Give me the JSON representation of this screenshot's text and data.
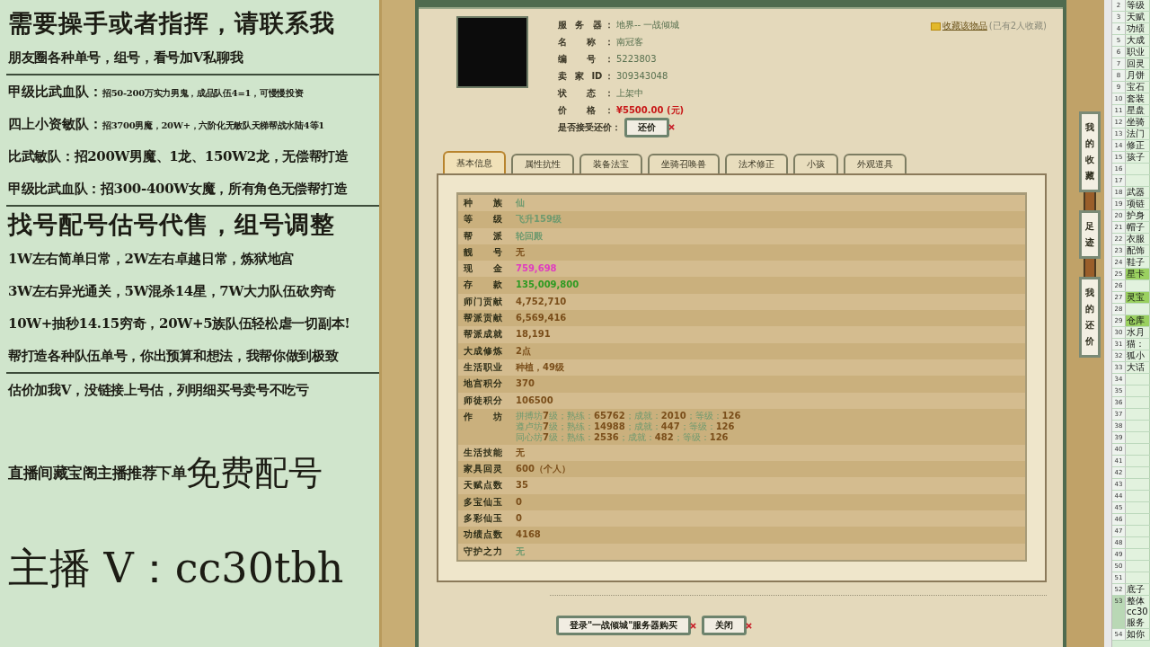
{
  "promo": {
    "items": [
      {
        "kind": "headline",
        "text": "需要操手或者指挥，请联系我"
      },
      {
        "kind": "line",
        "text": "朋友圈各种单号，组号，看号加V私聊我"
      },
      {
        "kind": "rule"
      },
      {
        "kind": "pair",
        "label": "甲级比武血队：",
        "text": "招50-200万实力男鬼，成品队伍4=1，可慢慢投资"
      },
      {
        "kind": "pair",
        "label": "四上小资敏队：",
        "text": "招3700男魔，20W+，六阶化无敏队天梯帮战水陆4等1"
      },
      {
        "kind": "line",
        "text": "比武敏队：招200W男魔、1龙、150W2龙，无偿帮打造"
      },
      {
        "kind": "line",
        "text": "甲级比武血队：招300-400W女魔，所有角色无偿帮打造"
      },
      {
        "kind": "rule"
      },
      {
        "kind": "headline",
        "text": "找号配号估号代售，组号调整"
      },
      {
        "kind": "line",
        "text": "1W左右简单日常，2W左右卓越日常，炼狱地宫"
      },
      {
        "kind": "line",
        "text": "3W左右异光通关，5W混杀14星，7W大力队伍砍穷奇"
      },
      {
        "kind": "line",
        "text": "10W+抽秒14.15穷奇，20W+5族队伍轻松虐一切副本!"
      },
      {
        "kind": "line",
        "text": "帮打造各种队伍单号，你出预算和想法，我帮你做到极致"
      },
      {
        "kind": "rule"
      },
      {
        "kind": "line",
        "text": "估价加我V，没链接上号估，列明细买号卖号不吃亏"
      },
      {
        "kind": "emphasis",
        "text": "直播间藏宝阁主播推荐下单",
        "big": "免费配号"
      },
      {
        "kind": "contact",
        "text": "主播 V：cc30tbh"
      }
    ]
  },
  "listing": {
    "fields": [
      {
        "label": "服 务 器：",
        "value": "地界-- 一战倾城",
        "kind": "text"
      },
      {
        "label": "名 称：",
        "value": "南冠客",
        "kind": "text"
      },
      {
        "label": "编 号：",
        "value": "5223803",
        "kind": "text"
      },
      {
        "label": "卖 家 ID：",
        "value": "309343048",
        "kind": "text"
      },
      {
        "label": "状 态：",
        "value": "上架中",
        "kind": "text"
      },
      {
        "label": "价 格：",
        "value": "¥5500.00 (元)",
        "kind": "price"
      }
    ],
    "favorite": {
      "link": "收藏该物品",
      "count": "(已有2人收藏)"
    },
    "counter_offer": {
      "label": "是否接受还价：",
      "button": "还价"
    },
    "tabs": [
      {
        "label": "基本信息",
        "selected": true
      },
      {
        "label": "属性抗性",
        "selected": false
      },
      {
        "label": "装备法宝",
        "selected": false
      },
      {
        "label": "坐骑召唤兽",
        "selected": false
      },
      {
        "label": "法术修正",
        "selected": false
      },
      {
        "label": "小孩",
        "selected": false
      },
      {
        "label": "外观道具",
        "selected": false
      }
    ],
    "rows": [
      {
        "label": "种 族",
        "value": "仙",
        "color": "#6f9a6f"
      },
      {
        "label": "等 级",
        "value": "飞升159级",
        "color": "#6f9a6f"
      },
      {
        "label": "帮 派",
        "value": "轮回殿",
        "color": "#6f9a6f"
      },
      {
        "label": "靓 号",
        "value": "无",
        "color": "#7a4e1a"
      },
      {
        "label": "现 金",
        "value": "759,698",
        "color": "#e03cc0"
      },
      {
        "label": "存 款",
        "value": "135,009,800",
        "color": "#2e9a22"
      },
      {
        "label": "师门贡献",
        "value": "4,752,710",
        "color": "#7a4e1a"
      },
      {
        "label": "帮派贡献",
        "value": "6,569,416",
        "color": "#7a4e1a"
      },
      {
        "label": "帮派成就",
        "value": "18,191",
        "color": "#7a4e1a"
      },
      {
        "label": "大成修炼",
        "value": "2点",
        "color": "#7a4e1a"
      },
      {
        "label": "生活职业",
        "value": "种植，49级",
        "color": "#7a4e1a"
      },
      {
        "label": "地宫积分",
        "value": "370",
        "color": "#7a4e1a"
      },
      {
        "label": "师徒积分",
        "value": "106500",
        "color": "#7a4e1a"
      },
      {
        "label": "作 坊",
        "lines": [
          [
            "拼搏坊",
            "7",
            "级；熟练：",
            "65762",
            "；成就：",
            "2010",
            "；等级：",
            "126"
          ],
          [
            "遵卢坊",
            "7",
            "级；熟练：",
            "14988",
            "；成就：",
            "447",
            "；等级：",
            "126"
          ],
          [
            "同心坊",
            "7",
            "级；熟练：",
            "2536",
            "；成就：",
            "482",
            "；等级：",
            "126"
          ]
        ]
      },
      {
        "label": "生活技能",
        "value": "无",
        "color": "#7a4e1a"
      },
      {
        "label": "家具回灵",
        "value": "600（个人）",
        "color": "#7a4e1a"
      },
      {
        "label": "天赋点数",
        "value": "35",
        "color": "#7a4e1a"
      },
      {
        "label": "多宝仙玉",
        "value": "0",
        "color": "#7a4e1a"
      },
      {
        "label": "多彩仙玉",
        "value": "0",
        "color": "#7a4e1a"
      },
      {
        "label": "功绩点数",
        "value": "4168",
        "color": "#7a4e1a"
      },
      {
        "label": "守护之力",
        "value": "无",
        "color": "#6f9a6f"
      }
    ],
    "buttons": [
      "登录\"一战倾城\"服务器购买",
      "关闭"
    ]
  },
  "side_tabs": [
    "我的收藏",
    "足迹",
    "我的还价"
  ],
  "sheet": {
    "rows": [
      {
        "number": "2",
        "lines": [
          "等级"
        ],
        "highlighted": false,
        "selected": false
      },
      {
        "number": "3",
        "lines": [
          "天赋"
        ],
        "highlighted": false,
        "selected": false
      },
      {
        "number": "4",
        "lines": [
          "功绩"
        ],
        "highlighted": false,
        "selected": false
      },
      {
        "number": "5",
        "lines": [
          "大成"
        ],
        "highlighted": false,
        "selected": false
      },
      {
        "number": "6",
        "lines": [
          "职业"
        ],
        "highlighted": false,
        "selected": false
      },
      {
        "number": "7",
        "lines": [
          "回灵"
        ],
        "highlighted": false,
        "selected": false
      },
      {
        "number": "8",
        "lines": [
          "月饼"
        ],
        "highlighted": false,
        "selected": false
      },
      {
        "number": "9",
        "lines": [
          "宝石"
        ],
        "highlighted": false,
        "selected": false
      },
      {
        "number": "10",
        "lines": [
          "套装"
        ],
        "highlighted": false,
        "selected": false
      },
      {
        "number": "11",
        "lines": [
          "星盘"
        ],
        "highlighted": false,
        "selected": false
      },
      {
        "number": "12",
        "lines": [
          "坐骑"
        ],
        "highlighted": false,
        "selected": false
      },
      {
        "number": "13",
        "lines": [
          "法门"
        ],
        "highlighted": false,
        "selected": false
      },
      {
        "number": "14",
        "lines": [
          "修正"
        ],
        "highlighted": false,
        "selected": false
      },
      {
        "number": "15",
        "lines": [
          "孩子"
        ],
        "highlighted": false,
        "selected": false
      },
      {
        "number": "16",
        "lines": [],
        "highlighted": false,
        "selected": false
      },
      {
        "number": "17",
        "lines": [],
        "highlighted": false,
        "selected": false
      },
      {
        "number": "18",
        "lines": [
          "武器"
        ],
        "highlighted": false,
        "selected": false
      },
      {
        "number": "19",
        "lines": [
          "项链"
        ],
        "highlighted": false,
        "selected": false
      },
      {
        "number": "20",
        "lines": [
          "护身"
        ],
        "highlighted": false,
        "selected": false
      },
      {
        "number": "21",
        "lines": [
          "帽子"
        ],
        "highlighted": false,
        "selected": false
      },
      {
        "number": "22",
        "lines": [
          "衣服"
        ],
        "highlighted": false,
        "selected": false
      },
      {
        "number": "23",
        "lines": [
          "配饰"
        ],
        "highlighted": false,
        "selected": false
      },
      {
        "number": "24",
        "lines": [
          "鞋子"
        ],
        "highlighted": false,
        "selected": false
      },
      {
        "number": "25",
        "lines": [
          "星卡"
        ],
        "highlighted": true,
        "selected": false
      },
      {
        "number": "26",
        "lines": [],
        "highlighted": false,
        "selected": false
      },
      {
        "number": "27",
        "lines": [
          "灵宝"
        ],
        "highlighted": true,
        "selected": false
      },
      {
        "number": "28",
        "lines": [],
        "highlighted": false,
        "selected": false
      },
      {
        "number": "29",
        "lines": [
          "仓库"
        ],
        "highlighted": true,
        "selected": false
      },
      {
        "number": "30",
        "lines": [
          "水月"
        ],
        "highlighted": false,
        "selected": false
      },
      {
        "number": "31",
        "lines": [
          "猫："
        ],
        "highlighted": false,
        "selected": false
      },
      {
        "number": "32",
        "lines": [
          "狐小"
        ],
        "highlighted": false,
        "selected": false
      },
      {
        "number": "33",
        "lines": [
          "大话"
        ],
        "highlighted": false,
        "selected": false
      },
      {
        "number": "34",
        "lines": [],
        "highlighted": false,
        "selected": false
      },
      {
        "number": "35",
        "lines": [],
        "highlighted": false,
        "selected": false
      },
      {
        "number": "36",
        "lines": [],
        "highlighted": false,
        "selected": false
      },
      {
        "number": "37",
        "lines": [],
        "highlighted": false,
        "selected": false
      },
      {
        "number": "38",
        "lines": [],
        "highlighted": false,
        "selected": false
      },
      {
        "number": "39",
        "lines": [],
        "highlighted": false,
        "selected": false
      },
      {
        "number": "40",
        "lines": [],
        "highlighted": false,
        "selected": false
      },
      {
        "number": "41",
        "lines": [],
        "highlighted": false,
        "selected": false
      },
      {
        "number": "42",
        "lines": [],
        "highlighted": false,
        "selected": false
      },
      {
        "number": "43",
        "lines": [],
        "highlighted": false,
        "selected": false
      },
      {
        "number": "44",
        "lines": [],
        "highlighted": false,
        "selected": false
      },
      {
        "number": "45",
        "lines": [],
        "highlighted": false,
        "selected": false
      },
      {
        "number": "46",
        "lines": [],
        "highlighted": false,
        "selected": false
      },
      {
        "number": "47",
        "lines": [],
        "highlighted": false,
        "selected": false
      },
      {
        "number": "48",
        "lines": [],
        "highlighted": false,
        "selected": false
      },
      {
        "number": "49",
        "lines": [],
        "highlighted": false,
        "selected": false
      },
      {
        "number": "50",
        "lines": [],
        "highlighted": false,
        "selected": false
      },
      {
        "number": "51",
        "lines": [],
        "highlighted": false,
        "selected": false
      },
      {
        "number": "52",
        "lines": [
          "底子"
        ],
        "highlighted": false,
        "selected": false
      },
      {
        "number": "53",
        "lines": [
          "整体",
          "cc30",
          "服务"
        ],
        "highlighted": false,
        "selected": true
      },
      {
        "number": "54",
        "lines": [
          "如你"
        ],
        "highlighted": false,
        "selected": false
      }
    ]
  }
}
